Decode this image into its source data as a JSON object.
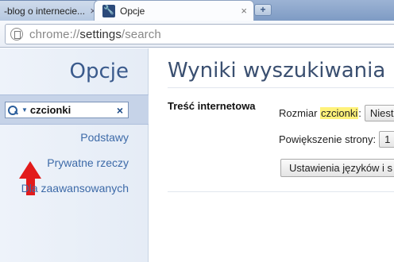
{
  "tabs": [
    {
      "label": "-blog o internecie...",
      "close": "×"
    },
    {
      "label": "Opcje",
      "close": "×"
    }
  ],
  "new_tab": "+",
  "omnibox": {
    "scheme": "chrome://",
    "host": "settings",
    "path": "/search"
  },
  "sidebar": {
    "title": "Opcje",
    "search": {
      "value": "czcionki",
      "clear": "×"
    },
    "items": [
      {
        "label": "Podstawy"
      },
      {
        "label": "Prywatne rzeczy"
      },
      {
        "label": "Dla zaawansowanych"
      }
    ]
  },
  "main": {
    "title": "Wyniki wyszukiwania",
    "section": "Treść internetowa",
    "font_size_prefix": "Rozmiar",
    "font_size_highlight": "czcionki",
    "font_size_suffix": ":",
    "font_size_value": "Niest",
    "zoom_label": "Powiększenie strony:",
    "zoom_value": "1",
    "languages_button": "Ustawienia języków i s"
  },
  "colors": {
    "arrow": "#e21b1b",
    "highlight": "#fff27a",
    "accent": "#3a5a8c"
  }
}
